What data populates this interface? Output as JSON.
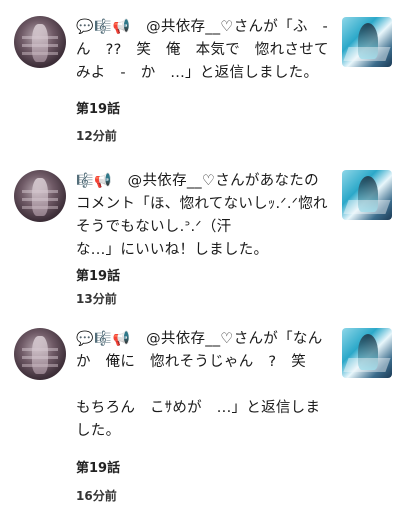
{
  "notifications": [
    {
      "icons": "💬🎼📢",
      "message_lines": [
        "　@共依存__♡さんが「ふ　-",
        "ん　??　笑　俺　本気で　惚れさせて",
        "みよ　-　か　...」と返信しました。"
      ],
      "chapter": "第19話",
      "time": "12分前"
    },
    {
      "icons": "🎼📢",
      "message_lines": [
        "　@共依存__♡さんがあなたの",
        "コメント「ほ、惚れてないしｯ.ᐟ.ᐟ惚れ",
        "そうでもないし.ᐣ.ᐟ（汗",
        "な...」にいいね！しました。"
      ],
      "chapter": "第19話",
      "time": "13分前"
    },
    {
      "icons": "💬🎼📢",
      "message_lines": [
        "　@共依存__♡さんが「なん",
        "か　俺に　惚れそうじゃん　?　笑",
        "",
        "もちろん　こｻめが　...」と返信しま",
        "した。"
      ],
      "chapter": "第19話",
      "time": "16分前"
    }
  ]
}
